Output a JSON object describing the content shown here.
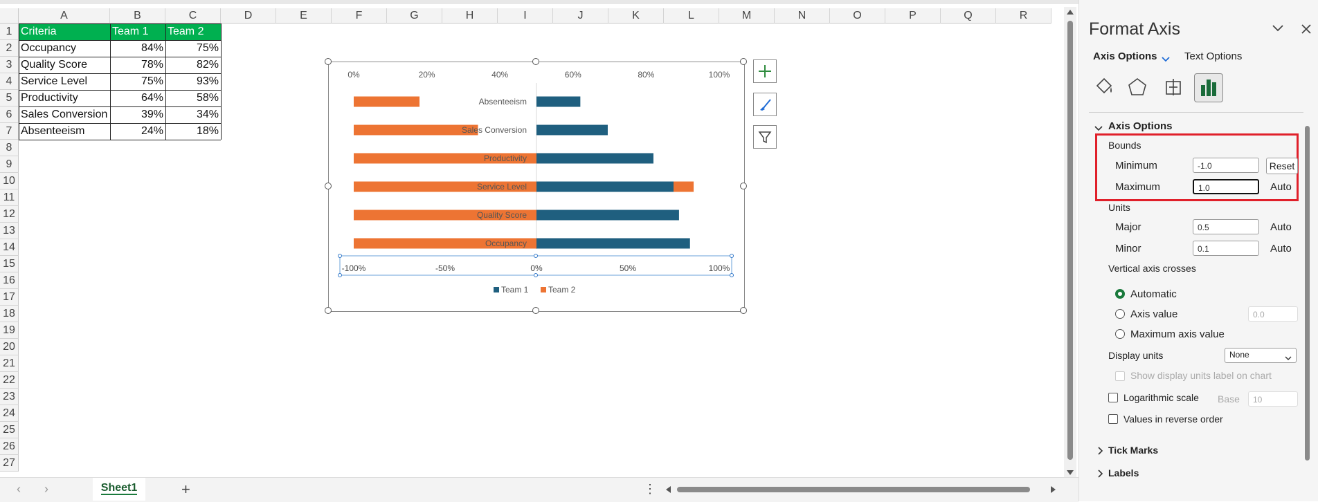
{
  "columns": [
    "A",
    "B",
    "C",
    "D",
    "E",
    "F",
    "G",
    "H",
    "I",
    "J",
    "K",
    "L",
    "M",
    "N",
    "O",
    "P",
    "Q",
    "R"
  ],
  "rows": [
    "1",
    "2",
    "3",
    "4",
    "5",
    "6",
    "7",
    "8",
    "9",
    "10",
    "11",
    "12",
    "13",
    "14",
    "15",
    "16",
    "17",
    "18",
    "19",
    "20",
    "21",
    "22",
    "23",
    "24",
    "25",
    "26",
    "27"
  ],
  "table": {
    "headers": [
      "Criteria",
      "Team 1",
      "Team 2"
    ],
    "rows": [
      [
        "Occupancy",
        "84%",
        "75%"
      ],
      [
        "Quality Score",
        "78%",
        "82%"
      ],
      [
        "Service Level",
        "75%",
        "93%"
      ],
      [
        "Productivity",
        "64%",
        "58%"
      ],
      [
        "Sales Conversion",
        "39%",
        "34%"
      ],
      [
        "Absenteeism",
        "24%",
        "18%"
      ]
    ]
  },
  "chart_data": {
    "type": "bar",
    "orientation": "horizontal",
    "categories": [
      "Absenteeism",
      "Sales Conversion",
      "Productivity",
      "Service Level",
      "Quality Score",
      "Occupancy"
    ],
    "series": [
      {
        "name": "Team 1",
        "color": "#1f5f7f",
        "values": [
          0.24,
          0.39,
          0.64,
          0.75,
          0.78,
          0.84
        ]
      },
      {
        "name": "Team 2",
        "color": "#ed7433",
        "values": [
          0.18,
          0.34,
          0.58,
          0.93,
          0.82,
          0.75
        ]
      }
    ],
    "top_axis_ticks": [
      "0%",
      "20%",
      "40%",
      "60%",
      "80%",
      "100%"
    ],
    "bottom_axis_ticks": [
      "-100%",
      "-50%",
      "0%",
      "50%",
      "100%"
    ],
    "xlim": [
      -1.0,
      1.0
    ],
    "legend_position": "bottom",
    "legend": [
      "Team 1",
      "Team 2"
    ]
  },
  "sheet": {
    "tab": "Sheet1",
    "add": "+",
    "more": "⋮"
  },
  "panel": {
    "title": "Format Axis",
    "tabs": {
      "axis_options": "Axis Options",
      "text_options": "Text Options"
    },
    "section": "Axis Options",
    "bounds": "Bounds",
    "minimum": {
      "label": "Minimum",
      "value": "-1.0",
      "button": "Reset"
    },
    "maximum": {
      "label": "Maximum",
      "value": "1.0",
      "button": "Auto"
    },
    "units": "Units",
    "major": {
      "label": "Major",
      "value": "0.5",
      "button": "Auto"
    },
    "minor": {
      "label": "Minor",
      "value": "0.1",
      "button": "Auto"
    },
    "vertical_axis_crosses": "Vertical axis crosses",
    "crosses_options": [
      "Automatic",
      "Axis value",
      "Maximum axis value"
    ],
    "axis_value": "0.0",
    "display_units": {
      "label": "Display units",
      "value": "None"
    },
    "show_units_label": "Show display units label on chart",
    "log_scale": {
      "label": "Logarithmic scale",
      "base_label": "Base",
      "base_value": "10"
    },
    "reverse": "Values in reverse order",
    "tick_marks": "Tick Marks",
    "labels": "Labels"
  },
  "highlight_color": "#e0202a"
}
